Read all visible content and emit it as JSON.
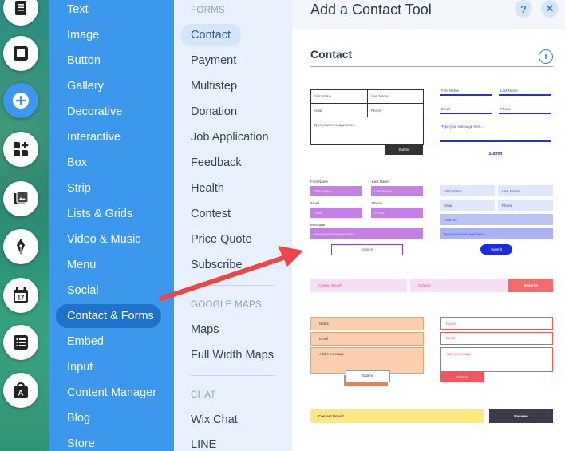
{
  "categories": [
    {
      "label": "Text"
    },
    {
      "label": "Image"
    },
    {
      "label": "Button"
    },
    {
      "label": "Gallery"
    },
    {
      "label": "Decorative"
    },
    {
      "label": "Interactive"
    },
    {
      "label": "Box"
    },
    {
      "label": "Strip"
    },
    {
      "label": "Lists & Grids"
    },
    {
      "label": "Video & Music"
    },
    {
      "label": "Menu"
    },
    {
      "label": "Social"
    },
    {
      "label": "Contact & Forms"
    },
    {
      "label": "Embed"
    },
    {
      "label": "Input"
    },
    {
      "label": "Content Manager"
    },
    {
      "label": "Blog"
    },
    {
      "label": "Store"
    }
  ],
  "sub_sections": {
    "forms_title": "FORMS",
    "forms": [
      {
        "label": "Contact"
      },
      {
        "label": "Payment"
      },
      {
        "label": "Multistep"
      },
      {
        "label": "Donation"
      },
      {
        "label": "Job Application"
      },
      {
        "label": "Feedback"
      },
      {
        "label": "Health"
      },
      {
        "label": "Contest"
      },
      {
        "label": "Price Quote"
      },
      {
        "label": "Subscribe"
      }
    ],
    "maps_title": "GOOGLE MAPS",
    "maps": [
      {
        "label": "Maps"
      },
      {
        "label": "Full Width Maps"
      }
    ],
    "chat_title": "CHAT",
    "chat": [
      {
        "label": "Wix Chat"
      },
      {
        "label": "LINE"
      }
    ]
  },
  "rail": {
    "icons": [
      "text-icon",
      "box-icon",
      "add-icon",
      "apps-icon",
      "media-icon",
      "pen-icon",
      "calendar-icon",
      "list-icon",
      "app-market-icon"
    ],
    "calendar_number": "17",
    "market_letter": "A"
  },
  "tool_panel": {
    "title": "Add a Contact Tool",
    "help": "?",
    "close": "✕",
    "section": "Contact",
    "info": "i",
    "form1": {
      "first": "First Name",
      "last": "Last Name",
      "email": "Email",
      "phone": "Phone",
      "message": "Type your message here...",
      "submit": "Submit"
    },
    "form2": {
      "first": "First Name",
      "last": "Last Name",
      "email": "Email",
      "phone": "Phone",
      "message": "Type your message here...",
      "submit": "Submit"
    },
    "form3": {
      "first": "First Name",
      "last": "Last Name",
      "email": "Email",
      "phone": "Phone",
      "message": "Message",
      "first_ph": "First Name",
      "last_ph": "Last Name",
      "email_ph": "Email",
      "phone_ph": "Phone",
      "message_ph": "Type your message here...",
      "submit": "Submit"
    },
    "form4": {
      "first": "First Name",
      "last": "Last Name",
      "email": "Email",
      "phone": "Phone",
      "address": "Address",
      "message": "Type your message here...",
      "submit": "Submit"
    },
    "form5": {
      "email": "Contact Email*",
      "subject": "Subject",
      "submit": "Reserve"
    },
    "form6": {
      "name": "Name",
      "email": "Email",
      "message": "Add a message",
      "submit": "Submit"
    },
    "form7": {
      "name": "Name",
      "email": "Email",
      "message": "Add a message",
      "submit": "Submit"
    },
    "form8": {
      "email": "Contact Email*",
      "submit": "Reserve"
    }
  },
  "colors": {
    "panel_blue": "#3b98ec",
    "selected_blue": "#1f72c9",
    "arrow_red": "#f0444a"
  }
}
